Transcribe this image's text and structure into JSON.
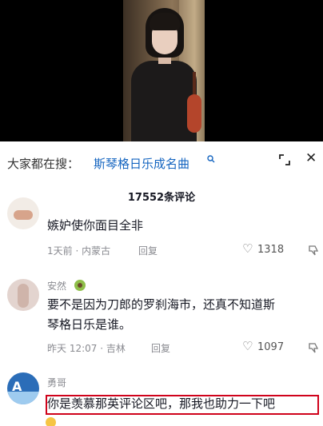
{
  "search": {
    "prefix": "大家都在搜：",
    "term": "斯琴格日乐成名曲"
  },
  "comments_header": {
    "count_label": "17552条评论"
  },
  "comments": [
    {
      "username": "",
      "text": "嫉妒使你面目全非",
      "time_location": "1天前 · 内蒙古",
      "reply_label": "回复",
      "likes": "1318"
    },
    {
      "username": "安然",
      "text_line1": "要不是因为刀郎的罗刹海市，还真不知道斯",
      "text_line2": "琴格日乐是谁。",
      "time_location": "昨天 12:07 · 吉林",
      "reply_label": "回复",
      "likes": "1097"
    },
    {
      "username": "勇哥",
      "text": "你是羡慕那英评论区吧，那我也助力一下吧"
    }
  ],
  "colors": {
    "link": "#1565c0",
    "highlight_border": "#d0021b"
  }
}
